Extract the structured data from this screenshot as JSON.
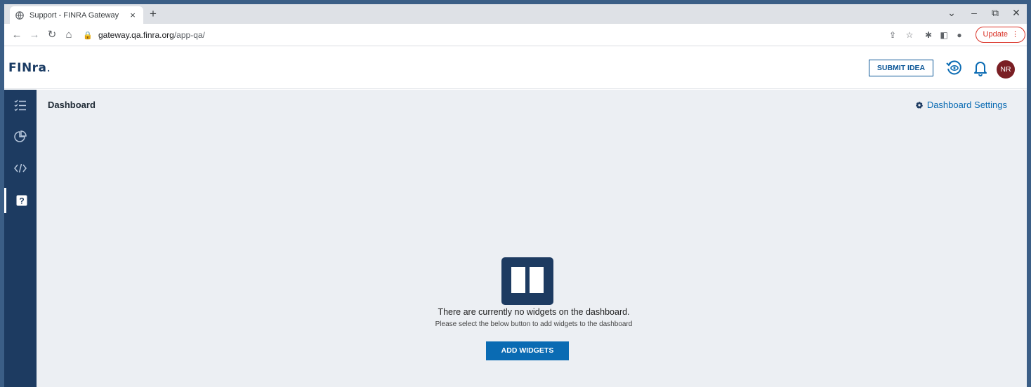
{
  "browser": {
    "tab_title": "Support - FINRA Gateway",
    "tab_close": "×",
    "new_tab": "+",
    "url_host": "gateway.qa.finra.org",
    "url_path": "/app-qa/",
    "update_label": "Update"
  },
  "header": {
    "logo_text": "FINra",
    "logo_dot": ".",
    "submit_idea": "SUBMIT IDEA",
    "avatar_initials": "NR"
  },
  "sidebar": {
    "items": [
      {
        "icon": "checklist-icon"
      },
      {
        "icon": "pie-chart-icon"
      },
      {
        "icon": "code-icon"
      },
      {
        "icon": "help-icon",
        "active": true
      }
    ]
  },
  "main": {
    "page_title": "Dashboard",
    "settings_label": "Dashboard Settings",
    "empty_title": "There are currently no widgets on the dashboard.",
    "empty_subtitle": "Please select the below button to add widgets to the dashboard",
    "add_widgets": "ADD WIDGETS"
  },
  "colors": {
    "sidebar_bg": "#1d3b61",
    "accent": "#0a6bb3",
    "avatar_bg": "#7a1f24",
    "main_bg": "#eceff3"
  }
}
